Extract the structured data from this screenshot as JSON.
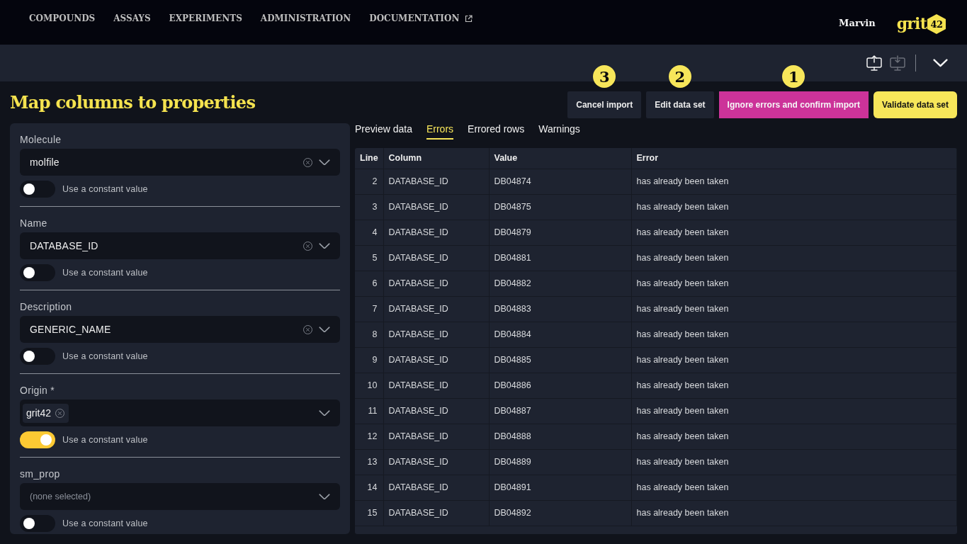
{
  "nav": {
    "links": [
      {
        "label": "COMPOUNDS",
        "external": false
      },
      {
        "label": "ASSAYS",
        "external": false
      },
      {
        "label": "EXPERIMENTS",
        "external": false
      },
      {
        "label": "ADMINISTRATION",
        "external": false
      },
      {
        "label": "DOCUMENTATION",
        "external": true
      }
    ],
    "user": "Marvin",
    "logo": {
      "word": "grit",
      "badge": "42"
    }
  },
  "toolbar": [
    {
      "kind": "upload",
      "disabled": false
    },
    {
      "kind": "download",
      "disabled": true
    }
  ],
  "page": {
    "title": "Map columns to properties",
    "actions": [
      {
        "label": "Cancel import",
        "kind": "secondary",
        "callout": "3"
      },
      {
        "label": "Edit data set",
        "kind": "secondary",
        "callout": "2"
      },
      {
        "label": "Ignore errors and confirm import",
        "kind": "accent",
        "callout": "1"
      },
      {
        "label": "Validate data set",
        "kind": "primary"
      }
    ]
  },
  "mappings": [
    {
      "label": "Molecule",
      "value": "molfile",
      "constant": false,
      "constant_label": "Use a constant value"
    },
    {
      "label": "Name",
      "value": "DATABASE_ID",
      "constant": false,
      "constant_label": "Use a constant value"
    },
    {
      "label": "Description",
      "value": "GENERIC_NAME",
      "constant": false,
      "constant_label": "Use a constant value"
    },
    {
      "label": "Origin *",
      "tags": [
        "grit42"
      ],
      "constant": true,
      "constant_label": "Use a constant value"
    },
    {
      "label": "sm_prop",
      "placeholder": "(none selected)",
      "constant": false,
      "constant_label": "Use a constant value"
    }
  ],
  "tabs": [
    {
      "label": "Preview data",
      "selected": false
    },
    {
      "label": "Errors",
      "selected": true
    },
    {
      "label": "Errored rows",
      "selected": false
    },
    {
      "label": "Warnings",
      "selected": false
    }
  ],
  "errors_table": {
    "columns": [
      "Line",
      "Column",
      "Value",
      "Error"
    ],
    "rows": [
      [
        "2",
        "DATABASE_ID",
        "DB04874",
        "has already been taken"
      ],
      [
        "3",
        "DATABASE_ID",
        "DB04875",
        "has already been taken"
      ],
      [
        "4",
        "DATABASE_ID",
        "DB04879",
        "has already been taken"
      ],
      [
        "5",
        "DATABASE_ID",
        "DB04881",
        "has already been taken"
      ],
      [
        "6",
        "DATABASE_ID",
        "DB04882",
        "has already been taken"
      ],
      [
        "7",
        "DATABASE_ID",
        "DB04883",
        "has already been taken"
      ],
      [
        "8",
        "DATABASE_ID",
        "DB04884",
        "has already been taken"
      ],
      [
        "9",
        "DATABASE_ID",
        "DB04885",
        "has already been taken"
      ],
      [
        "10",
        "DATABASE_ID",
        "DB04886",
        "has already been taken"
      ],
      [
        "11",
        "DATABASE_ID",
        "DB04887",
        "has already been taken"
      ],
      [
        "12",
        "DATABASE_ID",
        "DB04888",
        "has already been taken"
      ],
      [
        "13",
        "DATABASE_ID",
        "DB04889",
        "has already been taken"
      ],
      [
        "14",
        "DATABASE_ID",
        "DB04891",
        "has already been taken"
      ],
      [
        "15",
        "DATABASE_ID",
        "DB04892",
        "has already been taken"
      ]
    ]
  }
}
